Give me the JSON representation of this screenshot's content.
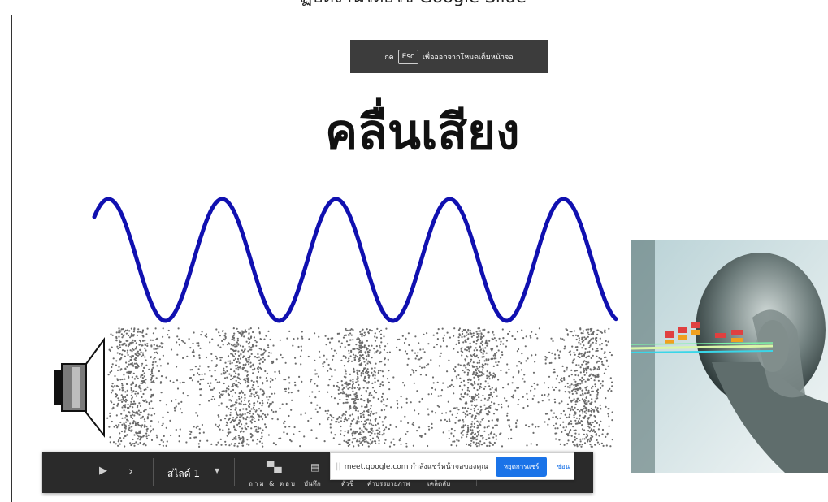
{
  "page": {
    "top_caption": "ฏิบัติงานโดยใช้ Google Slide",
    "esc_banner": {
      "prefix": "กด",
      "key": "Esc",
      "suffix": "เพื่อออกจากโหมดเต็มหน้าจอ"
    },
    "slide_title": "คลื่นเสียง"
  },
  "presenter_bar": {
    "slide_label": "สไลด์ 1",
    "qa_label": "ถาม & ตอบ",
    "notes_label": "บันทึก",
    "font_label": "ตัวชี้",
    "caption_label": "คำบรรยายภาพ",
    "tips_label": "เคล็ดลับ"
  },
  "share_popup": {
    "message": "meet.google.com กำลังแชร์หน้าจอของคุณ",
    "stop_label": "หยุดการแชร์",
    "hide_label": "ซ่อน"
  },
  "colors": {
    "wave": "#1010b0",
    "bar_bg": "#2a2a2a",
    "accent_blue": "#1a73e8"
  },
  "icons": [
    "play-icon",
    "next-icon",
    "chevron-down-icon",
    "qa-icon",
    "notes-icon",
    "pointer-icon",
    "captions-icon",
    "tips-icon",
    "drag-handle-icon"
  ]
}
